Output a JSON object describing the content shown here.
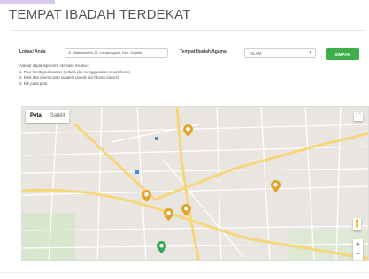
{
  "page": {
    "title": "TEMPAT IBADAH TERDEKAT"
  },
  "form": {
    "location_label": "Lokasi Anda",
    "location_value": "Jl. Wawaran No.29, Lempongsari, Kec. Gajahm",
    "religion_label": "Tempat Ibadah Agama",
    "religion_selected": "ISLAM",
    "save_label": "SIMPAN",
    "notes": [
      "Alamat dapat diperoleh otomatis melalui :",
      "1. Fitur html5 geolocation (terbaik jika menggunakan smartphone)",
      "2. ketik dan ditentu auto suggest google api (library places)",
      "3. klik pada peta"
    ]
  },
  "map": {
    "type_tabs": [
      "Peta",
      "Satelit"
    ],
    "active_tab": "Peta",
    "fullscreen_icon": "fullscreen-icon",
    "zoom_in": "+",
    "zoom_out": "−",
    "colors": {
      "worship_marker": "#e0a52a",
      "user_marker": "#34a853",
      "road": "#ffffff",
      "main_road": "#f9d77e",
      "land": "#e9e6e1"
    }
  }
}
